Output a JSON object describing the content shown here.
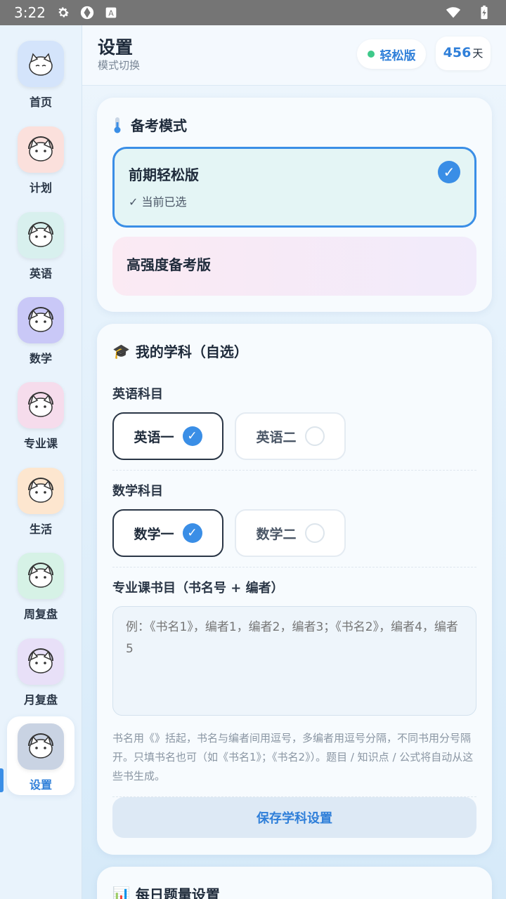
{
  "status_bar": {
    "time": "3:22",
    "icons": [
      "gear-icon",
      "app-icon",
      "a-icon",
      "wifi-icon",
      "battery-icon"
    ]
  },
  "sidebar": {
    "items": [
      {
        "label": "首页",
        "bg": "#d4e4fb"
      },
      {
        "label": "计划",
        "bg": "#fbe0dc"
      },
      {
        "label": "英语",
        "bg": "#d8f0ee"
      },
      {
        "label": "数学",
        "bg": "#c9c8f7"
      },
      {
        "label": "专业课",
        "bg": "#f6dcec"
      },
      {
        "label": "生活",
        "bg": "#fde6cf"
      },
      {
        "label": "周复盘",
        "bg": "#d6f2e6"
      },
      {
        "label": "月复盘",
        "bg": "#e8e0f8"
      },
      {
        "label": "设置",
        "bg": "#c9d3e3"
      }
    ]
  },
  "header": {
    "title": "设置",
    "subtitle": "模式切换",
    "mode_badge": "轻松版",
    "days_num": "456",
    "days_unit": "天"
  },
  "exam_mode": {
    "title": "备考模式",
    "options": [
      {
        "label": "前期轻松版",
        "sub": "✓ 当前已选"
      },
      {
        "label": "高强度备考版"
      }
    ]
  },
  "subjects": {
    "title": "我的学科（自选）",
    "english_label": "英语科目",
    "english_options": [
      "英语一",
      "英语二"
    ],
    "math_label": "数学科目",
    "math_options": [
      "数学一",
      "数学二"
    ],
    "books_label": "专业课书目（书名号 + 编者）",
    "books_placeholder": "例：《书名1》，编者1，编者2，编者3；《书名2》，编者4，编者5",
    "hint": "书名用《》括起，书名与编者间用逗号，多编者用逗号分隔，不同书用分号隔开。只填书名也可（如《书名1》；《书名2》）。题目 / 知识点 / 公式将自动从这些书生成。",
    "save_label": "保存学科设置"
  },
  "daily": {
    "title": "每日题量设置"
  },
  "colors": {
    "accent": "#3a8ee6",
    "green_dot": "#3ec98a"
  }
}
